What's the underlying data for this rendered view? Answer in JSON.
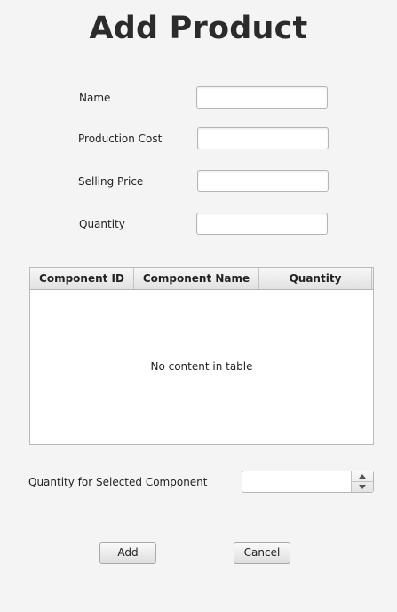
{
  "page": {
    "title": "Add Product"
  },
  "form": {
    "name": {
      "label": "Name",
      "value": ""
    },
    "production_cost": {
      "label": "Production Cost",
      "value": ""
    },
    "selling_price": {
      "label": "Selling Price",
      "value": ""
    },
    "quantity": {
      "label": "Quantity",
      "value": ""
    }
  },
  "components_table": {
    "columns": [
      "Component ID",
      "Component Name",
      "Quantity"
    ],
    "rows": [],
    "empty_message": "No content in table"
  },
  "component_quantity": {
    "label": "Quantity for Selected Component",
    "value": ""
  },
  "actions": {
    "add_label": "Add",
    "cancel_label": "Cancel"
  }
}
